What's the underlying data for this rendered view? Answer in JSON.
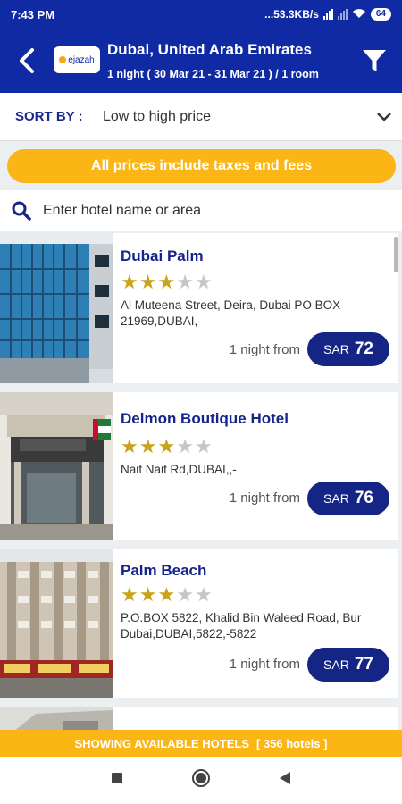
{
  "status": {
    "time": "7:43 PM",
    "speed": "...53.3KB/s",
    "battery": "64"
  },
  "header": {
    "title": "Dubai, United Arab Emirates",
    "subtitle": "1 night ( 30 Mar 21 - 31 Mar 21 )  / 1 room",
    "logo_text": "ejazah"
  },
  "sort": {
    "label": "SORT BY :",
    "value": "Low to high price"
  },
  "notice": "All prices include taxes and fees",
  "search": {
    "placeholder": "Enter hotel name or area"
  },
  "hotels": [
    {
      "name": "Dubai Palm",
      "stars": 3,
      "max_stars": 5,
      "address": "Al Muteena Street, Deira, Dubai PO BOX 21969,DUBAI,-",
      "from_label": "1 night from",
      "currency": "SAR",
      "price": "72"
    },
    {
      "name": "Delmon Boutique Hotel",
      "stars": 3,
      "max_stars": 5,
      "address": "Naif Naif Rd,DUBAI,,-",
      "from_label": "1 night from",
      "currency": "SAR",
      "price": "76"
    },
    {
      "name": "Palm Beach",
      "stars": 3,
      "max_stars": 5,
      "address": "P.O.BOX 5822, Khalid Bin Waleed Road, Bur Dubai,DUBAI,5822,-5822",
      "from_label": "1 night from",
      "currency": "SAR",
      "price": "77"
    }
  ],
  "banner": {
    "label": "SHOWING AVAILABLE HOTELS",
    "count": "[ 356 hotels ]"
  },
  "colors": {
    "primary": "#0f2aa3",
    "accent": "#fbb615",
    "star": "#c9a41a",
    "price_pill": "#142585"
  }
}
